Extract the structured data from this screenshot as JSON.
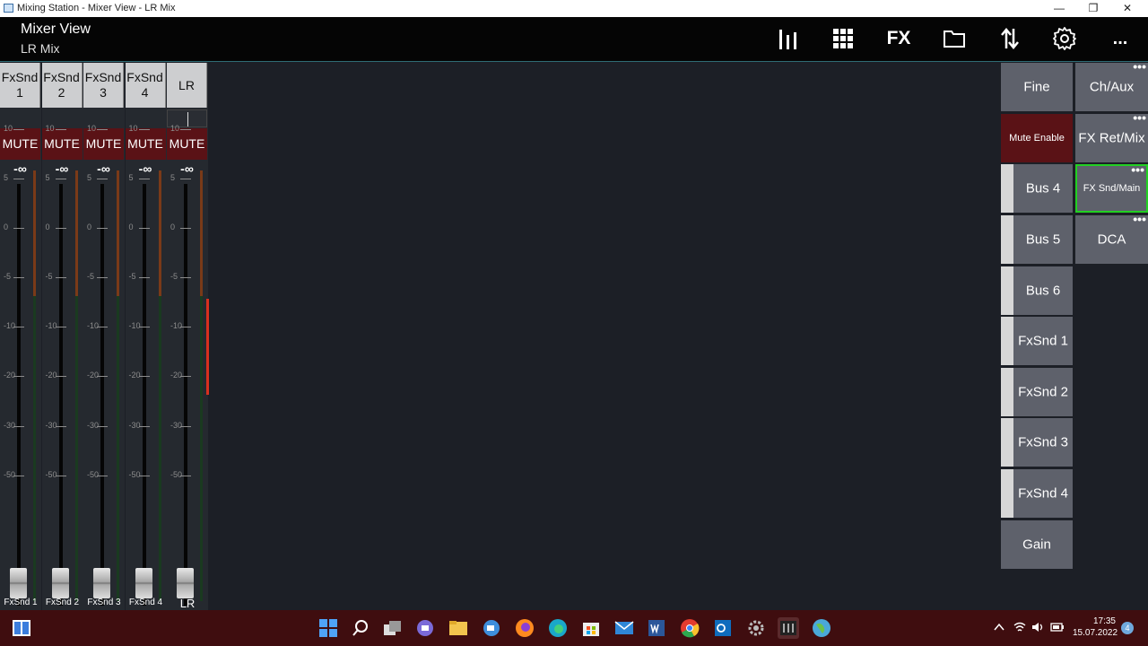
{
  "window": {
    "title": "Mixing Station - Mixer View - LR Mix",
    "minimize": "—",
    "restore": "❐",
    "close": "✕"
  },
  "header": {
    "title": "Mixer View",
    "subtitle": "LR Mix",
    "toolbar": {
      "fx_label": "FX",
      "more_label": "..."
    }
  },
  "scale_labels": [
    "10",
    "5",
    "0",
    "-5",
    "-10",
    "-20",
    "-30",
    "-50"
  ],
  "strips": [
    {
      "header": "FxSnd\n1",
      "mute": "MUTE",
      "level": "-∞",
      "name": "FxSnd 1"
    },
    {
      "header": "FxSnd\n2",
      "mute": "MUTE",
      "level": "-∞",
      "name": "FxSnd 2"
    },
    {
      "header": "FxSnd\n3",
      "mute": "MUTE",
      "level": "-∞",
      "name": "FxSnd 3"
    },
    {
      "header": "FxSnd\n4",
      "mute": "MUTE",
      "level": "-∞",
      "name": "FxSnd 4"
    },
    {
      "header": "LR",
      "mute": "MUTE",
      "level": "-∞",
      "name": "LR"
    }
  ],
  "bus_buttons": [
    {
      "label": "Fine"
    },
    {
      "label": "Mute Enable"
    },
    {
      "label": "Bus 4"
    },
    {
      "label": "Bus 5"
    },
    {
      "label": "Bus 6"
    },
    {
      "label": "FxSnd 1"
    },
    {
      "label": "FxSnd 2"
    },
    {
      "label": "FxSnd 3"
    },
    {
      "label": "FxSnd 4"
    },
    {
      "label": "Gain"
    }
  ],
  "group_buttons": [
    {
      "label": "Ch/Aux",
      "more": "•••"
    },
    {
      "label": "FX Ret/Mix",
      "more": "•••"
    },
    {
      "label": "FX Snd/Main",
      "more": "•••"
    },
    {
      "label": "DCA",
      "more": "•••"
    }
  ],
  "taskbar": {
    "time": "17:35",
    "date": "15.07.2022",
    "notifications": "4"
  },
  "colors": {
    "mute_red": "#5a1216",
    "selected_green": "#22d022",
    "button_gray": "#5e616b",
    "taskbar": "#3f0d0f"
  }
}
